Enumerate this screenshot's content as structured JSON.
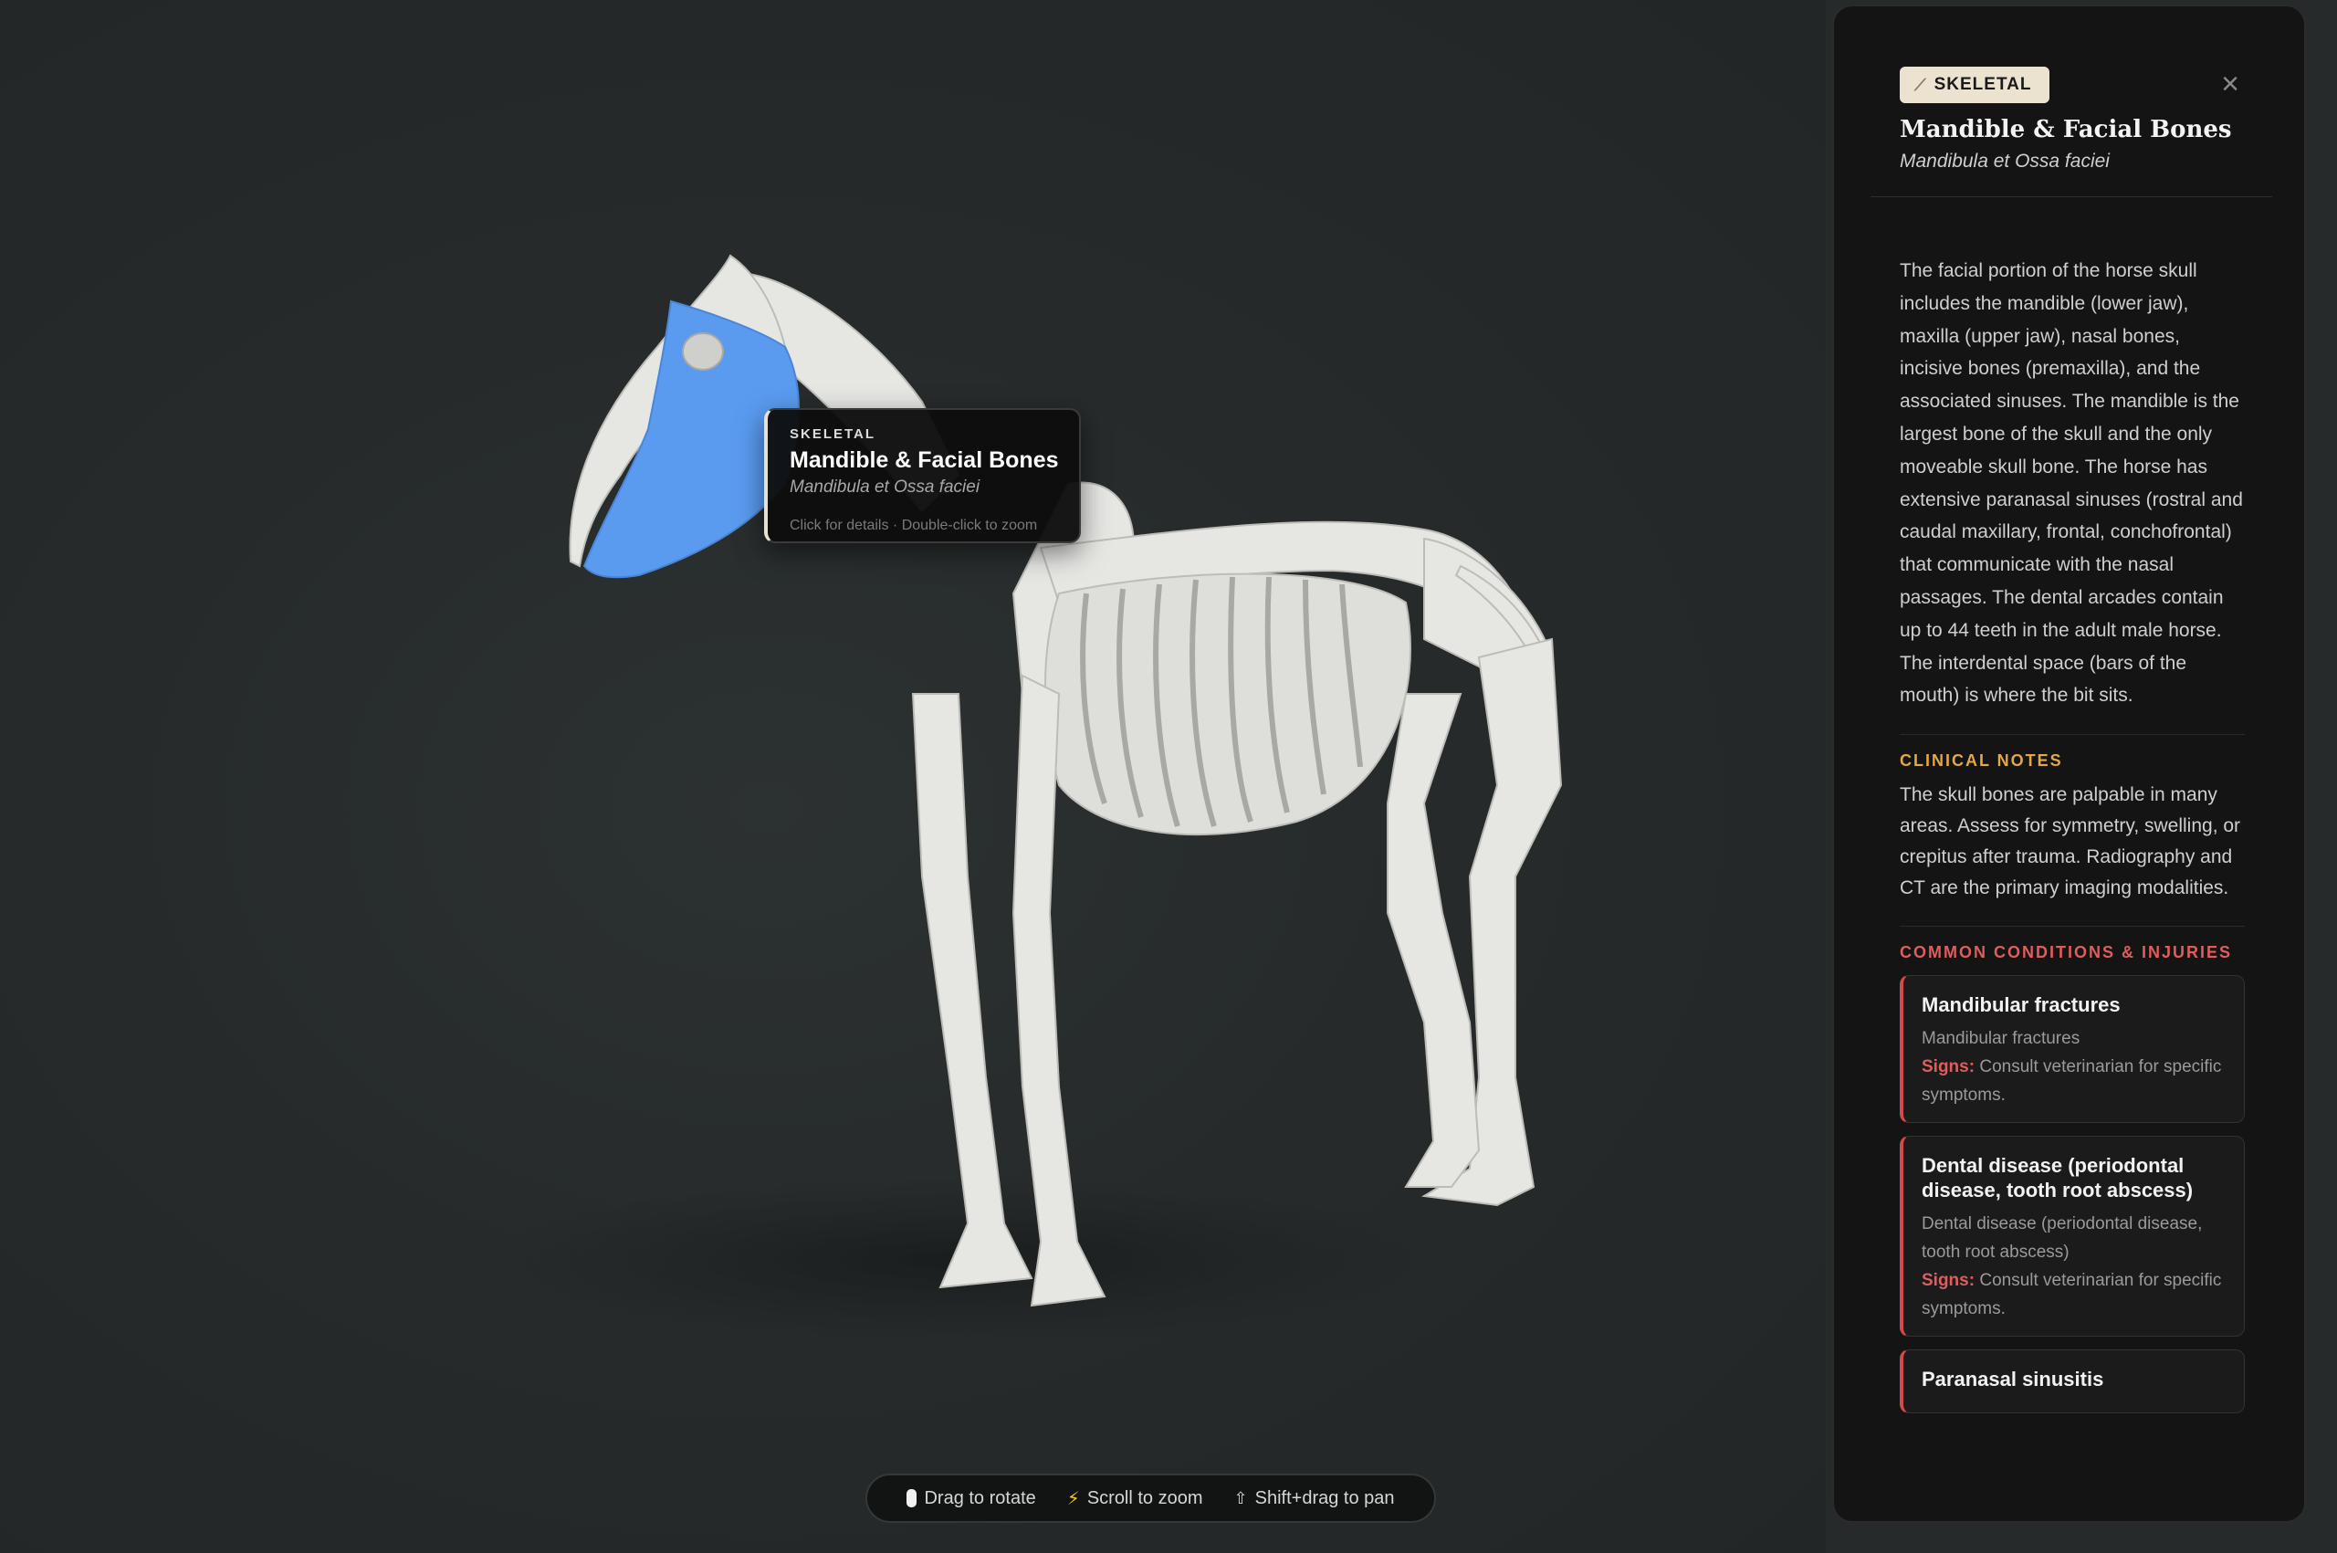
{
  "viewer": {
    "highlight_color": "#5a9bf0",
    "bone_color": "#e6e6e3",
    "tooltip": {
      "category": "SKELETAL",
      "title": "Mandible & Facial Bones",
      "latin": "Mandibula et Ossa faciei",
      "hint": "Click for details · Double-click to zoom"
    },
    "controls": [
      {
        "icon": "mouse-icon",
        "label": "Drag to rotate"
      },
      {
        "icon": "bolt-icon",
        "label": "Scroll to zoom"
      },
      {
        "icon": "shift-icon",
        "label": "Shift+drag to pan"
      }
    ]
  },
  "panel": {
    "badge": "SKELETAL",
    "badge_icon": "bone-icon",
    "title": "Mandible & Facial Bones",
    "latin": "Mandibula et Ossa faciei",
    "description": "The facial portion of the horse skull includes the mandible (lower jaw), maxilla (upper jaw), nasal bones, incisive bones (premaxilla), and the associated sinuses. The mandible is the largest bone of the skull and the only moveable skull bone. The horse has extensive paranasal sinuses (rostral and caudal maxillary, frontal, conchofrontal) that communicate with the nasal passages. The dental arcades contain up to 44 teeth in the adult male horse. The interdental space (bars of the mouth) is where the bit sits.",
    "clinical_title": "CLINICAL NOTES",
    "clinical_text": "The skull bones are palpable in many areas. Assess for symmetry, swelling, or crepitus after trauma. Radiography and CT are the primary imaging modalities.",
    "conditions_title": "COMMON CONDITIONS & INJURIES",
    "signs_label": "Signs:",
    "conditions": [
      {
        "title": "Mandibular fractures",
        "desc": "Mandibular fractures",
        "signs": "Consult veterinarian for specific symptoms."
      },
      {
        "title": "Dental disease (periodontal disease, tooth root abscess)",
        "desc": "Dental disease (periodontal disease, tooth root abscess)",
        "signs": "Consult veterinarian for specific symptoms."
      },
      {
        "title": "Paranasal sinusitis"
      }
    ]
  }
}
